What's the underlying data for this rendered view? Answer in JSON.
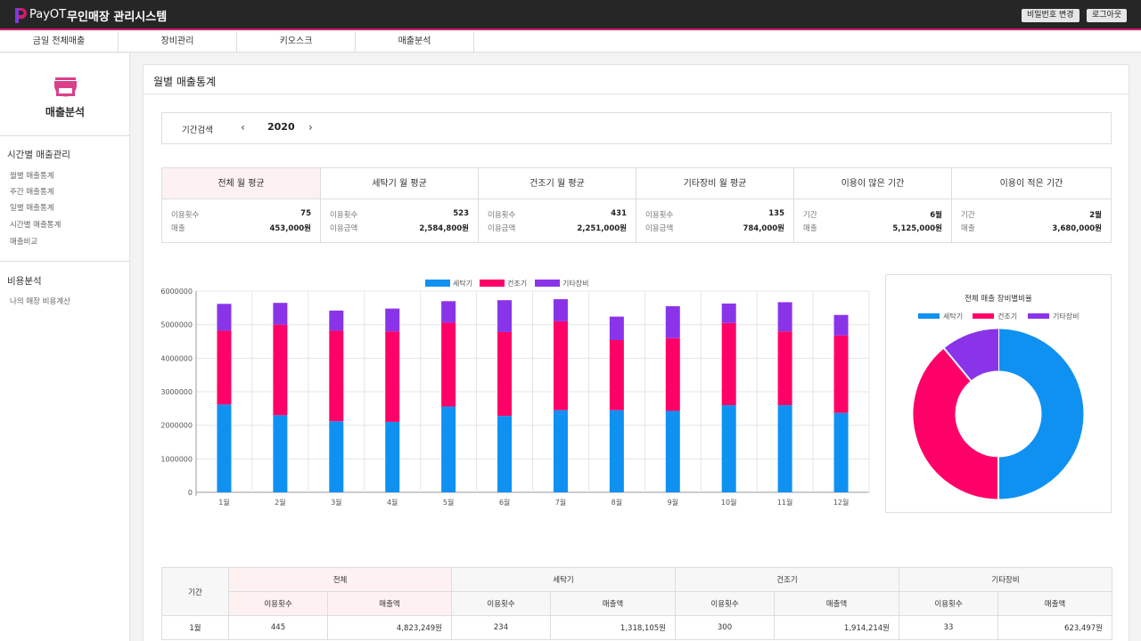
{
  "header": {
    "brand": "PayOT",
    "system_title": "무인매장 관리시스템",
    "change_password_label": "비밀번호 변경",
    "logout_label": "로그아웃"
  },
  "nav": {
    "items": [
      "금일 전체매출",
      "장비관리",
      "키오스크",
      "매출분석"
    ]
  },
  "sidebar": {
    "title": "매출분석",
    "groups": [
      {
        "label": "시간별 매출관리",
        "links": [
          "월별 매출통계",
          "주간 매출통계",
          "일별 매출통계",
          "시간별 매출통계",
          "매출비교"
        ]
      },
      {
        "label": "비용분석",
        "links": [
          "나의 매장 비용계산"
        ]
      }
    ]
  },
  "page": {
    "title": "월별 매출통계",
    "period_label": "기간검색",
    "year": "2020",
    "prev_icon": "‹",
    "next_icon": "›"
  },
  "cards": [
    {
      "title": "전체 월 평균",
      "rows": [
        [
          "이용횟수",
          "75"
        ],
        [
          "매출",
          "453,000원"
        ]
      ]
    },
    {
      "title": "세탁기 월 평균",
      "rows": [
        [
          "이용횟수",
          "523"
        ],
        [
          "이용금액",
          "2,584,800원"
        ]
      ]
    },
    {
      "title": "건조기 월 평균",
      "rows": [
        [
          "이용횟수",
          "431"
        ],
        [
          "이용금액",
          "2,251,000원"
        ]
      ]
    },
    {
      "title": "기타장비 월 평균",
      "rows": [
        [
          "이용횟수",
          "135"
        ],
        [
          "이용금액",
          "784,000원"
        ]
      ]
    },
    {
      "title": "이용이 많은 기간",
      "rows": [
        [
          "기간",
          "6월"
        ],
        [
          "매출",
          "5,125,000원"
        ]
      ]
    },
    {
      "title": "이용이 적은 기간",
      "rows": [
        [
          "기간",
          "2월"
        ],
        [
          "매출",
          "3,680,000원"
        ]
      ]
    }
  ],
  "colors": {
    "washer": "#0f91f2",
    "dryer": "#ff0069",
    "other": "#8a34e9",
    "accent": "#d31b6c"
  },
  "chart_data": [
    {
      "type": "bar",
      "stacked": true,
      "categories": [
        "1월",
        "2월",
        "3월",
        "4월",
        "5월",
        "6월",
        "7월",
        "8월",
        "9월",
        "10월",
        "11월",
        "12월"
      ],
      "series": [
        {
          "name": "세탁기",
          "values": [
            2620000,
            2300000,
            2120000,
            2100000,
            2560000,
            2280000,
            2450000,
            2450000,
            2430000,
            2600000,
            2600000,
            2370000
          ]
        },
        {
          "name": "건조기",
          "values": [
            2200000,
            2700000,
            2700000,
            2700000,
            2500000,
            2500000,
            2650000,
            2090000,
            2170000,
            2450000,
            2200000,
            2310000
          ]
        },
        {
          "name": "기타장비",
          "values": [
            800000,
            650000,
            600000,
            680000,
            640000,
            950000,
            660000,
            700000,
            950000,
            580000,
            870000,
            610000
          ]
        }
      ],
      "ylim": [
        0,
        6000000
      ],
      "yticks": [
        0,
        1000000,
        2000000,
        3000000,
        4000000,
        5000000,
        6000000
      ],
      "legend": "top-center",
      "grid": true
    },
    {
      "type": "pie",
      "title": "전체 매출 장비별비율",
      "donut": true,
      "labels": [
        "세탁기",
        "건조기",
        "기타장비"
      ],
      "values": [
        50,
        39,
        11
      ],
      "legend": "top-center"
    }
  ],
  "table": {
    "header_period": "기간",
    "groups": [
      "전체",
      "세탁기",
      "건조기",
      "기타장비"
    ],
    "subheaders": [
      "이용횟수",
      "매출액"
    ],
    "rows": [
      {
        "period": "1월",
        "cells": [
          "445",
          "4,823,249원",
          "234",
          "1,318,105원",
          "300",
          "1,914,214원",
          "33",
          "623,497원"
        ]
      }
    ]
  }
}
